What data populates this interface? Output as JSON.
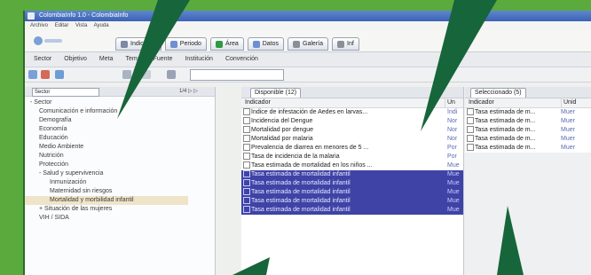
{
  "window": {
    "title": "ColombiaInfo 1.0 - ColombiaInfo"
  },
  "menubar": [
    "Archivo",
    "Editar",
    "Vista",
    "Ayuda"
  ],
  "top_tabs": [
    {
      "label": "Indicador",
      "color": "#7c8aa3"
    },
    {
      "label": "Periodo",
      "color": "#6e8fd0"
    },
    {
      "label": "Área",
      "color": "#2f9a3f"
    },
    {
      "label": "Datos",
      "color": "#6e8fd0"
    },
    {
      "label": "Galería",
      "color": "#8a8f98"
    },
    {
      "label": "Inf",
      "color": "#8a8f98"
    }
  ],
  "navbar": [
    "Sector",
    "Objetivo",
    "Meta",
    "Tema",
    "Fuente",
    "Institución",
    "Convención"
  ],
  "left_panel": {
    "combo_value": "Sector",
    "pager": "1/4 ▷ ▷",
    "tree": [
      {
        "label": "- Sector",
        "level": 0
      },
      {
        "label": "Comunicación e información",
        "level": 1
      },
      {
        "label": "Demografía",
        "level": 1
      },
      {
        "label": "Economía",
        "level": 1
      },
      {
        "label": "Educación",
        "level": 1
      },
      {
        "label": "Medio Ambiente",
        "level": 1
      },
      {
        "label": "Nutrición",
        "level": 1
      },
      {
        "label": "Protección",
        "level": 1
      },
      {
        "label": "- Salud y supervivencia",
        "level": 1
      },
      {
        "label": "Inmunización",
        "level": 2
      },
      {
        "label": "Maternidad sin riesgos",
        "level": 2
      },
      {
        "label": "Mortalidad y morbilidad infantil",
        "level": 2,
        "selected": true
      },
      {
        "label": "+ Situación de las mujeres",
        "level": 1
      },
      {
        "label": "VIH / SIDA",
        "level": 1
      }
    ]
  },
  "mid_panel": {
    "tab_label": "Disponible (12)",
    "col_indicator": "Indicador",
    "col_unit": "Un",
    "rows": [
      {
        "indicator": "Índice de infestación de Aedes en larvas...",
        "unit": "Índi",
        "selected": false
      },
      {
        "indicator": "Incidencia del Dengue",
        "unit": "Nor",
        "selected": false
      },
      {
        "indicator": "Mortalidad por dengue",
        "unit": "Nor",
        "selected": false
      },
      {
        "indicator": "Mortalidad por malaria",
        "unit": "Nor",
        "selected": false
      },
      {
        "indicator": "Prevalencia de diarrea en menores de 5 ...",
        "unit": "Por",
        "selected": false
      },
      {
        "indicator": "Tasa de incidencia de la malaria",
        "unit": "Por",
        "selected": false
      },
      {
        "indicator": "Tasa estimada de mortalidad en los niños ...",
        "unit": "Mue",
        "selected": false
      },
      {
        "indicator": "Tasa estimada de mortalidad infantil",
        "unit": "Mue",
        "selected": true
      },
      {
        "indicator": "Tasa estimada de mortalidad infantil",
        "unit": "Mue",
        "selected": true
      },
      {
        "indicator": "Tasa estimada de mortalidad infantil",
        "unit": "Mue",
        "selected": true
      },
      {
        "indicator": "Tasa estimada de mortalidad infantil",
        "unit": "Mue",
        "selected": true
      },
      {
        "indicator": "Tasa estimada de mortalidad infantil",
        "unit": "Mue",
        "selected": true
      }
    ]
  },
  "right_panel": {
    "tab_label": "Seleccionado (5)",
    "col_indicator": "Indicador",
    "col_unit": "Unid",
    "rows": [
      {
        "indicator": "Tasa estimada de m...",
        "unit": "Muer"
      },
      {
        "indicator": "Tasa estimada de m...",
        "unit": "Muer"
      },
      {
        "indicator": "Tasa estimada de m...",
        "unit": "Muer"
      },
      {
        "indicator": "Tasa estimada de m...",
        "unit": "Muer"
      },
      {
        "indicator": "Tasa estimada de m...",
        "unit": "Muer"
      }
    ]
  },
  "colors": {
    "background": "#5aaa3e",
    "pointer": "#17653a",
    "selection": "#3f43a6"
  }
}
